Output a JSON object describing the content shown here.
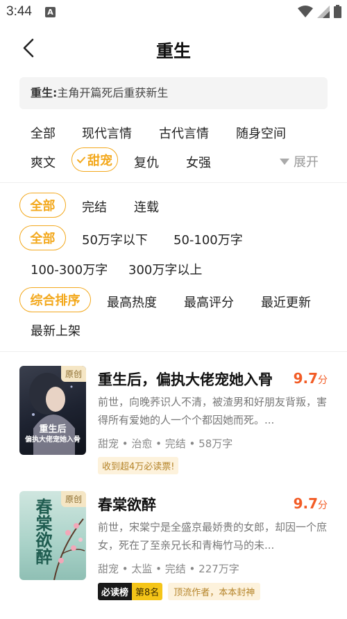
{
  "status_bar": {
    "time": "3:44",
    "notification_icon": "A"
  },
  "header": {
    "title": "重生",
    "back_icon": "chevron-left-icon"
  },
  "description": {
    "label": "重生:",
    "text": "主角开篇死后重获新生"
  },
  "categories": {
    "row1": [
      "全部",
      "现代言情",
      "古代言情",
      "随身空间"
    ],
    "row2": [
      "爽文",
      "甜宠",
      "复仇",
      "女强"
    ],
    "selected": "甜宠",
    "expand_label": "展开"
  },
  "filters": {
    "status": {
      "options": [
        "全部",
        "完结",
        "连载"
      ],
      "selected": "全部"
    },
    "word_count": {
      "options": [
        "全部",
        "50万字以下",
        "50-100万字",
        "100-300万字",
        "300万字以上"
      ],
      "selected": "全部"
    },
    "sort": {
      "options": [
        "综合排序",
        "最高热度",
        "最高评分",
        "最近更新",
        "最新上架"
      ],
      "selected": "综合排序"
    }
  },
  "books": [
    {
      "title": "重生后，偏执大佬宠她入骨",
      "score": "9.7",
      "score_unit": "分",
      "description": "前世，向晚荞识人不清，被渣男和好朋友背叛，害得所有爱她的人一个个都因她而死。...",
      "meta": "甜宠 • 治愈 • 完结 • 58万字",
      "badge": "原创",
      "rank_tag": "收到超4万必读票!",
      "cover_text_line1": "重生后",
      "cover_text_line2": "偏执大佬宠她入骨"
    },
    {
      "title": "春棠欲醉",
      "score": "9.7",
      "score_unit": "分",
      "description": "前世，宋棠宁是全盛京最娇贵的女郎，却因一个庶女，死在了至亲兄长和青梅竹马的未...",
      "meta": "甜宠 • 太监 • 完结 • 227万字",
      "badge": "原创",
      "must_read_label": "必读榜",
      "must_read_rank": "第8名",
      "extra_tag": "顶流作者，本本封神",
      "cover_text": "春棠欲醉"
    }
  ],
  "colors": {
    "accent": "#f3a81c",
    "score": "#f25c26"
  }
}
